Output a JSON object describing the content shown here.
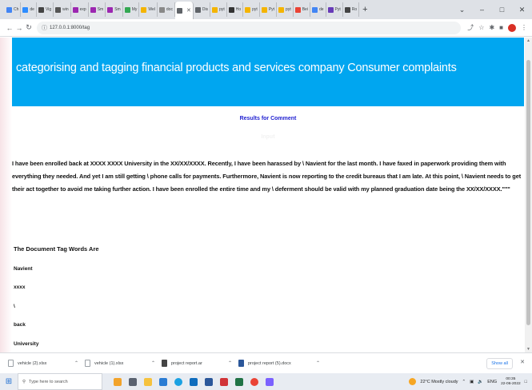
{
  "browser": {
    "tabs": [
      {
        "label": "Ch",
        "color": "#4285f4"
      },
      {
        "label": "de",
        "color": "#2d8cff"
      },
      {
        "label": "Vig",
        "color": "#444444"
      },
      {
        "label": "win",
        "color": "#555555"
      },
      {
        "label": "exp",
        "color": "#9c27b0"
      },
      {
        "label": "Sm",
        "color": "#9c27b0"
      },
      {
        "label": "Sm",
        "color": "#9c27b0"
      },
      {
        "label": "My",
        "color": "#34a853"
      },
      {
        "label": "Wel",
        "color": "#f4b400"
      },
      {
        "label": "doc",
        "color": "#888888"
      },
      {
        "label": "",
        "color": "#5f6368",
        "active": true
      },
      {
        "label": "Dis",
        "color": "#5f6368"
      },
      {
        "label": "pyt",
        "color": "#f4b400"
      },
      {
        "label": "Ho",
        "color": "#333333"
      },
      {
        "label": "pyt",
        "color": "#f4b400"
      },
      {
        "label": "Pyt",
        "color": "#f4b400"
      },
      {
        "label": "pyt",
        "color": "#f4b400"
      },
      {
        "label": "Bei",
        "color": "#ea4335"
      },
      {
        "label": "de",
        "color": "#4285f4"
      },
      {
        "label": "Pyt",
        "color": "#673ab7"
      },
      {
        "label": "Ro",
        "color": "#444444"
      }
    ],
    "url": "127.0.0.1:8000/tag"
  },
  "page": {
    "title": "categorising and tagging financial products and services company Consumer complaints",
    "results_label": "Results for Comment",
    "comment_label": "Input",
    "comment_text": "I have been enrolled back at XXXX XXXX University in the XX/XX/XXXX. Recently, I have been harassed by \\ Navient for the last month. I have faxed in paperwork providing them with everything they needed. And yet I am still getting \\ phone calls for payments. Furthermore, Navient is now reporting to the credit bureaus that I am late. At this point, \\ Navient needs to get their act together to avoid me taking further action. I have been enrolled the entire time and my \\ deferment should be valid with my planned graduation date being the XX/XX/XXXX.\"\"\"",
    "tag_heading": "The Document Tag Words Are",
    "tag_words": [
      "Navient",
      "xxxx",
      "\\",
      "back",
      "University"
    ]
  },
  "downloads": {
    "items": [
      {
        "name": "vehicle (2).xlsx"
      },
      {
        "name": "vehicle (1).xlsx"
      },
      {
        "name": "project report.ar"
      },
      {
        "name": "project report (5).docx"
      }
    ],
    "show_all": "Show all"
  },
  "taskbar": {
    "search_placeholder": "Type here to search",
    "weather": "22°C Mostly cloudy",
    "lang": "ENG",
    "time": "00:35",
    "date": "22-06-2022"
  }
}
